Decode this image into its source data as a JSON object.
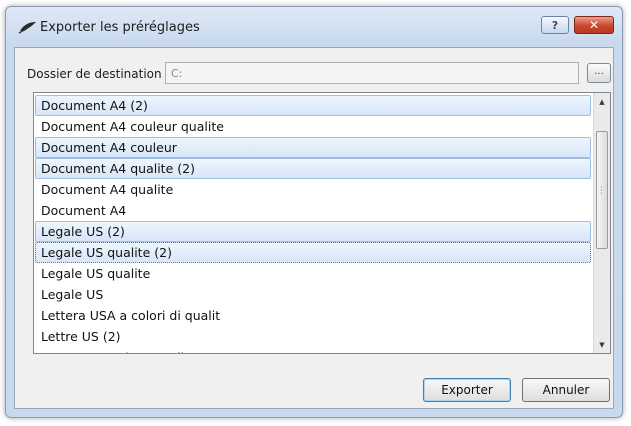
{
  "window": {
    "title": "Exporter les préréglages",
    "help_label": "?",
    "close_label": "✕"
  },
  "destination": {
    "label": "Dossier de destination",
    "value": "C:",
    "browse_label": "..."
  },
  "presets": {
    "items": [
      {
        "label": "Document A4 (2)",
        "selected": true
      },
      {
        "label": "Document A4 couleur qualite",
        "selected": false
      },
      {
        "label": "Document A4 couleur",
        "selected": true
      },
      {
        "label": "Document A4 qualite (2)",
        "selected": true
      },
      {
        "label": "Document A4 qualite",
        "selected": false
      },
      {
        "label": "Document A4",
        "selected": false
      },
      {
        "label": "Legale US (2)",
        "selected": true
      },
      {
        "label": "Legale US qualite (2)",
        "selected": true,
        "focused": true
      },
      {
        "label": "Legale US qualite",
        "selected": false
      },
      {
        "label": "Legale US",
        "selected": false
      },
      {
        "label": "Lettera USA a colori di qualit",
        "selected": false
      },
      {
        "label": "Lettre US (2)",
        "selected": false
      },
      {
        "label": "Lettre US couleur qualite",
        "selected": false
      }
    ]
  },
  "buttons": {
    "export_label": "Exporter",
    "cancel_label": "Annuler"
  },
  "icons": {
    "app": "scanner-pen-icon",
    "scroll_up": "scroll-up-arrow-icon",
    "scroll_down": "scroll-down-arrow-icon"
  }
}
